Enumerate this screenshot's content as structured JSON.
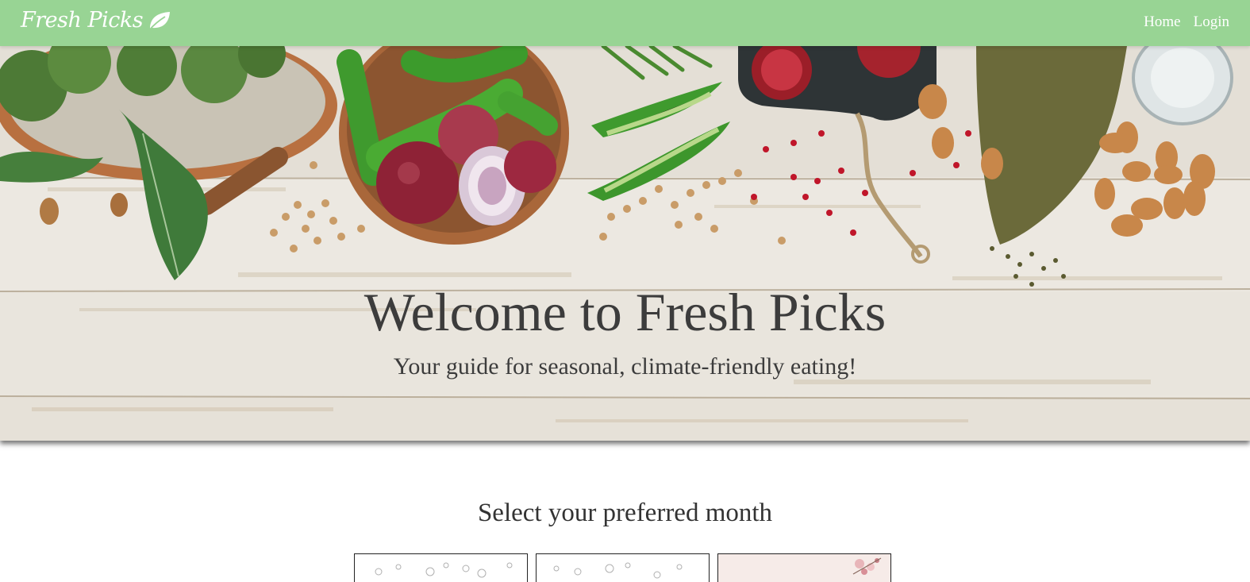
{
  "navbar": {
    "brand": "Fresh Picks",
    "brand_icon": "leaf-icon",
    "links": [
      {
        "label": "Home"
      },
      {
        "label": "Login"
      }
    ],
    "background_color": "#98d494"
  },
  "hero": {
    "title": "Welcome to Fresh Picks",
    "subtitle": "Your guide for seasonal, climate-friendly eating!"
  },
  "months_section": {
    "heading": "Select your preferred month"
  }
}
